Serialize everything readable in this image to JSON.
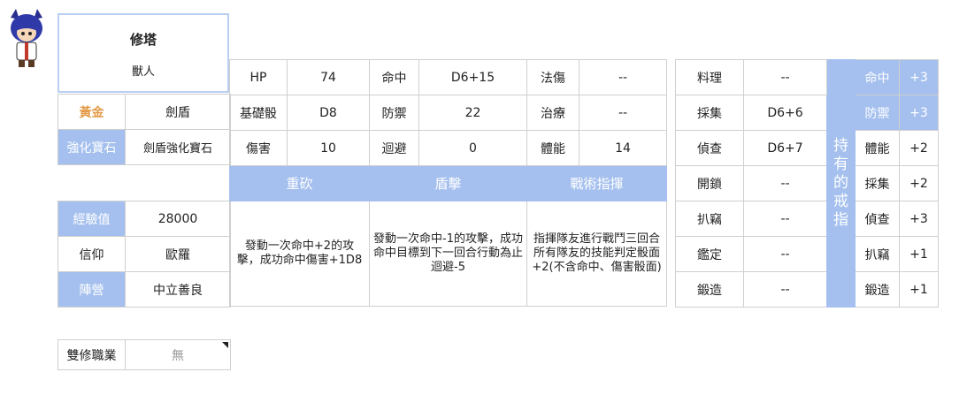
{
  "character": {
    "name": "修塔",
    "race": "獸人"
  },
  "class_row": {
    "rank": "黃金",
    "weapon": "劍盾"
  },
  "gem_row": {
    "label": "強化寶石",
    "value": "劍盾強化寶石"
  },
  "info_rows": [
    {
      "label": "經驗值",
      "value": "28000"
    },
    {
      "label": "信仰",
      "value": "歐羅"
    },
    {
      "label": "陣營",
      "value": "中立善良"
    }
  ],
  "dual_class": {
    "label": "雙修職業",
    "value": "無"
  },
  "stats": [
    [
      "HP",
      "74",
      "命中",
      "D6+15",
      "法傷",
      "--"
    ],
    [
      "基礎骰",
      "D8",
      "防禦",
      "22",
      "治療",
      "--"
    ],
    [
      "傷害",
      "10",
      "迴避",
      "0",
      "體能",
      "14"
    ]
  ],
  "skills": [
    {
      "name": "重砍",
      "desc": "發動一次命中+2的攻擊，成功命中傷害+1D8"
    },
    {
      "name": "盾擊",
      "desc": "發動一次命中-1的攻擊，成功命中目標到下一回合行動為止迴避-5"
    },
    {
      "name": "戰術指揮",
      "desc": "指揮隊友進行戰鬥三回合所有隊友的技能判定骰面+2(不含命中、傷害骰面)"
    }
  ],
  "abilities": [
    {
      "label": "料理",
      "value": "--"
    },
    {
      "label": "採集",
      "value": "D6+6"
    },
    {
      "label": "偵查",
      "value": "D6+7"
    },
    {
      "label": "開鎖",
      "value": "--"
    },
    {
      "label": "扒竊",
      "value": "--"
    },
    {
      "label": "鑑定",
      "value": "--"
    },
    {
      "label": "鍛造",
      "value": "--"
    }
  ],
  "ring": {
    "title": "持有的戒指",
    "bonuses": [
      {
        "label": "命中",
        "value": "+3",
        "highlight": true
      },
      {
        "label": "防禦",
        "value": "+3",
        "highlight": true
      },
      {
        "label": "體能",
        "value": "+2",
        "highlight": false
      },
      {
        "label": "採集",
        "value": "+2",
        "highlight": false
      },
      {
        "label": "偵查",
        "value": "+3",
        "highlight": false
      },
      {
        "label": "扒竊",
        "value": "+1",
        "highlight": false
      },
      {
        "label": "鍛造",
        "value": "+1",
        "highlight": false
      }
    ]
  },
  "colors": {
    "accent_blue": "#a5c0ee",
    "gold": "#e39b48",
    "border": "#cfcfcf"
  },
  "icons": {
    "avatar": "wolf-boy-avatar-icon",
    "dropdown_corner": "corner-triangle-icon"
  }
}
